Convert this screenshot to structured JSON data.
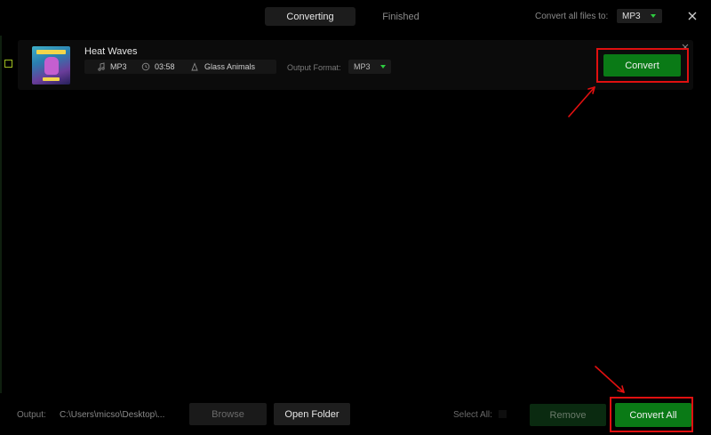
{
  "header": {
    "tabs": [
      {
        "label": "Converting",
        "active": true
      },
      {
        "label": "Finished",
        "active": false
      }
    ],
    "convert_all_label": "Convert all files to:",
    "convert_all_format": "MP3"
  },
  "item": {
    "title": "Heat Waves",
    "format": "MP3",
    "duration": "03:58",
    "artist": "Glass Animals",
    "output_format_label": "Output Format:",
    "output_format": "MP3",
    "convert_label": "Convert"
  },
  "footer": {
    "output_label": "Output:",
    "output_path": "C:\\Users\\micso\\Desktop\\...",
    "browse_label": "Browse",
    "open_folder_label": "Open Folder",
    "select_all_label": "Select All:",
    "remove_label": "Remove",
    "convert_all_label": "Convert All"
  },
  "colors": {
    "accent_green": "#0a7a16",
    "highlight_red": "#e01010",
    "checkbox_border": "#9fbf20"
  },
  "icons": [
    "close-icon",
    "music-note-icon",
    "clock-icon",
    "artist-icon",
    "chevron-down-icon"
  ]
}
